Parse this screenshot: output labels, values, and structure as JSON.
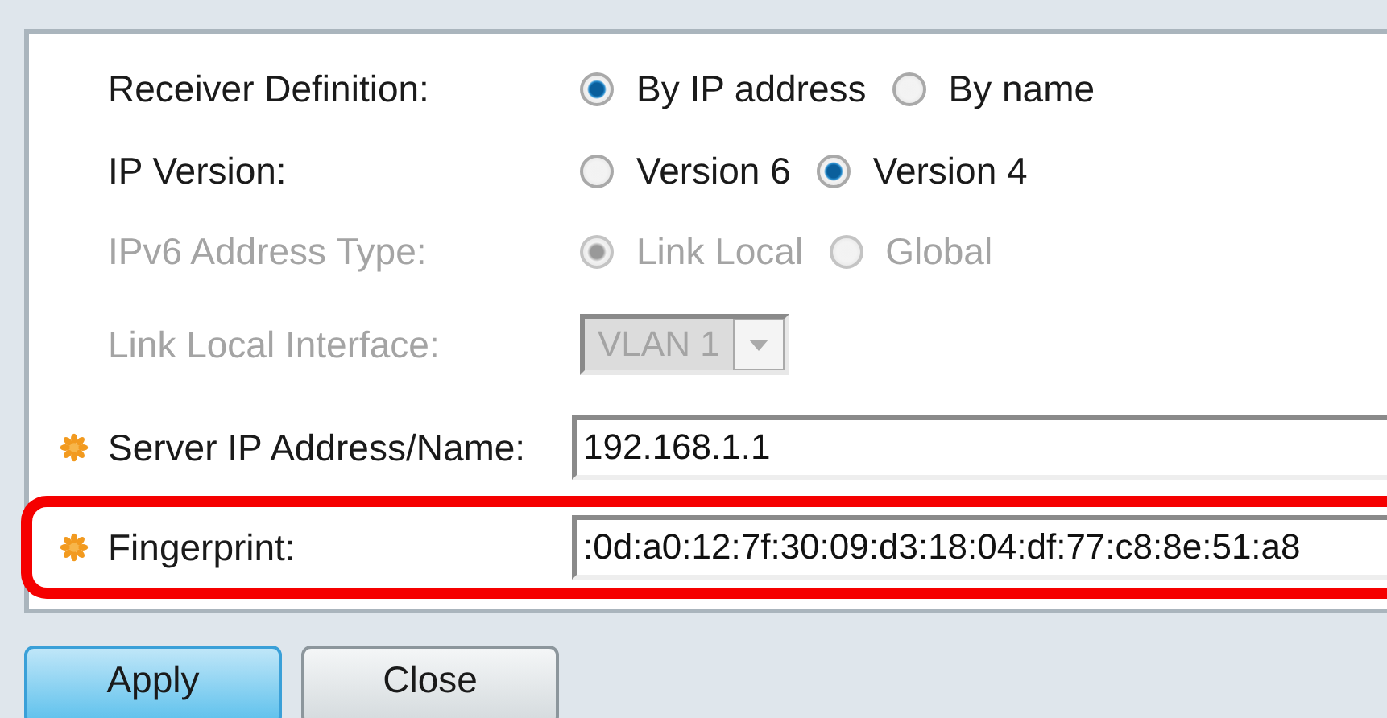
{
  "form": {
    "rows": [
      {
        "kind": "radio",
        "label": "Receiver Definition:",
        "disabled": false,
        "required": false,
        "highlighted": false,
        "options": [
          {
            "label": "By IP address",
            "selected": true
          },
          {
            "label": "By name",
            "selected": false
          }
        ]
      },
      {
        "kind": "radio",
        "label": "IP Version:",
        "disabled": false,
        "required": false,
        "highlighted": false,
        "options": [
          {
            "label": "Version 6",
            "selected": false
          },
          {
            "label": "Version 4",
            "selected": true
          }
        ]
      },
      {
        "kind": "radio",
        "label": "IPv6 Address Type:",
        "disabled": true,
        "required": false,
        "highlighted": false,
        "options": [
          {
            "label": "Link Local",
            "selected": true
          },
          {
            "label": "Global",
            "selected": false
          }
        ]
      },
      {
        "kind": "select",
        "label": "Link Local Interface:",
        "disabled": true,
        "required": false,
        "highlighted": false,
        "value": "VLAN 1"
      },
      {
        "kind": "text",
        "label": "Server IP Address/Name:",
        "disabled": false,
        "required": true,
        "highlighted": false,
        "value": "192.168.1.1"
      },
      {
        "kind": "text",
        "label": "Fingerprint:",
        "disabled": false,
        "required": true,
        "highlighted": true,
        "value": ":0d:a0:12:7f:30:09:d3:18:04:df:77:c8:8e:51:a8"
      }
    ]
  },
  "buttons": [
    {
      "label": "Apply",
      "kind": "primary"
    },
    {
      "label": "Close",
      "kind": "secondary"
    }
  ]
}
